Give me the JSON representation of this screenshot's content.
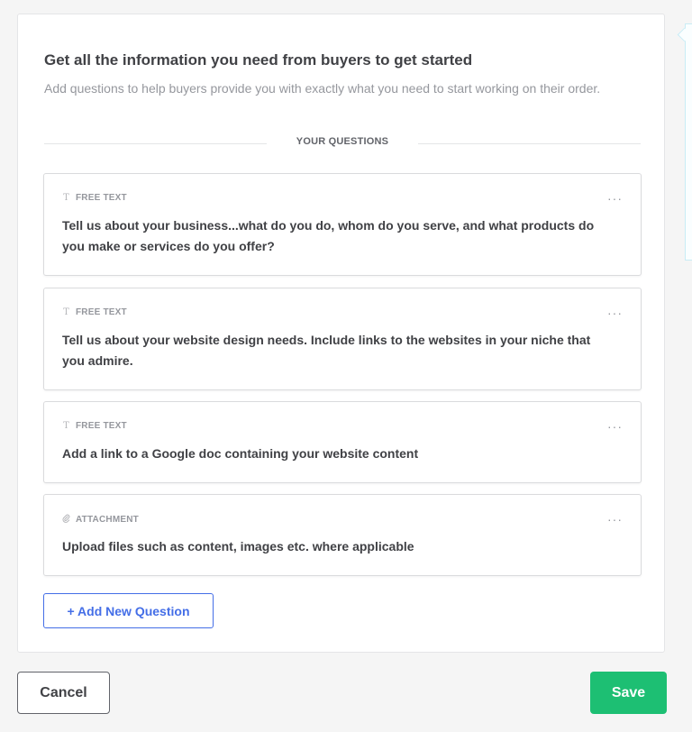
{
  "header": {
    "title": "Get all the information you need from buyers to get started",
    "subtitle": "Add questions to help buyers provide you with exactly what you need to start working on their order."
  },
  "divider": {
    "label": "YOUR QUESTIONS"
  },
  "questions": [
    {
      "type": "FREE TEXT",
      "type_icon": "text-type-icon",
      "text": "Tell us about your business...what do you do, whom do you serve, and what products do you make or services do you offer?",
      "menu": "···"
    },
    {
      "type": "FREE TEXT",
      "type_icon": "text-type-icon",
      "text": "Tell us about your website design needs. Include links to the websites in your niche that you admire.",
      "menu": "···"
    },
    {
      "type": "FREE TEXT",
      "type_icon": "text-type-icon",
      "text": "Add a link to a Google doc containing your website content",
      "menu": "···"
    },
    {
      "type": "ATTACHMENT",
      "type_icon": "paperclip-icon",
      "text": "Upload files such as content, images etc. where applicable",
      "menu": "···"
    }
  ],
  "actions": {
    "add_question_label": "+ Add New Question",
    "cancel_label": "Cancel",
    "save_label": "Save"
  },
  "colors": {
    "accent_blue": "#446ee7",
    "save_green": "#1dbf73",
    "text_dark": "#404145",
    "text_muted": "#95979d"
  }
}
